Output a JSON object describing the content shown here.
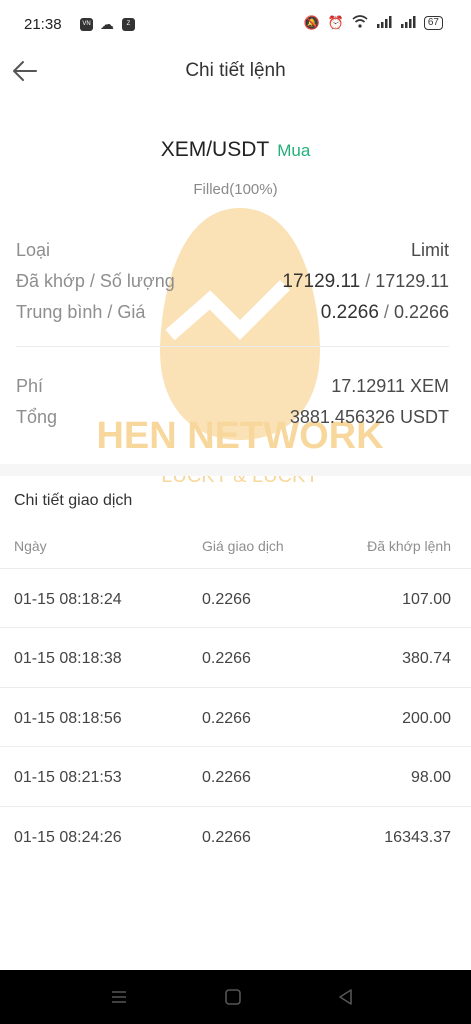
{
  "statusbar": {
    "time": "21:38",
    "battery": "67"
  },
  "header": {
    "title": "Chi tiết lệnh"
  },
  "order": {
    "pair": "XEM/USDT",
    "side": "Mua",
    "status": "Filled(100%)",
    "type_label": "Loại",
    "type_value": "Limit",
    "filled_label": "Đã khớp / Số lượng",
    "filled_value": "17129.11",
    "amount_value": "17129.11",
    "avg_label": "Trung bình / Giá",
    "avg_value": "0.2266",
    "price_value": "0.2266",
    "fee_label": "Phí",
    "fee_value": "17.12911 XEM",
    "total_label": "Tổng",
    "total_value": "3881.456326 USDT"
  },
  "trades": {
    "title": "Chi tiết giao dịch",
    "headers": {
      "date": "Ngày",
      "price": "Giá giao dịch",
      "filled": "Đã khớp lệnh"
    },
    "rows": [
      {
        "date": "01-15 08:18:24",
        "price": "0.2266",
        "filled": "107.00"
      },
      {
        "date": "01-15 08:18:38",
        "price": "0.2266",
        "filled": "380.74"
      },
      {
        "date": "01-15 08:18:56",
        "price": "0.2266",
        "filled": "200.00"
      },
      {
        "date": "01-15 08:21:53",
        "price": "0.2266",
        "filled": "98.00"
      },
      {
        "date": "01-15 08:24:26",
        "price": "0.2266",
        "filled": "16343.37"
      }
    ]
  },
  "watermark": {
    "brand": "HEN NETWORK",
    "slogan": "LUCKY & LUCKY"
  },
  "colors": {
    "buy": "#23b07a",
    "watermark": "#f2b84a"
  }
}
